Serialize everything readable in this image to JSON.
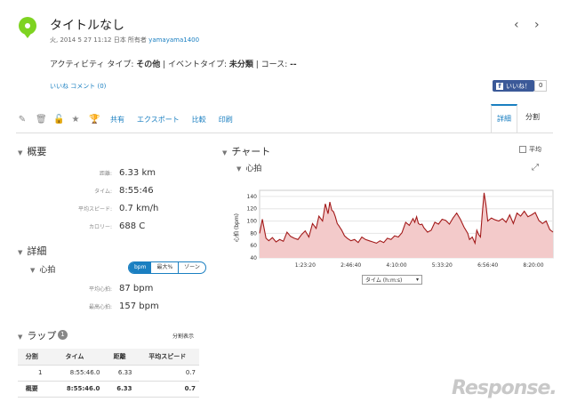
{
  "header": {
    "title": "タイトルなし",
    "date": "火, 2014 5 27 11:12 日本 所有者",
    "owner": "yamayama1400",
    "prev_glyph": "‹",
    "next_glyph": "›"
  },
  "activity": {
    "type_label": "アクティビティ タイプ: ",
    "type_value": "その他",
    "event_label": " | イベントタイプ: ",
    "event_value": "未分類",
    "course_label": " | コース: ",
    "course_value": "--"
  },
  "social": {
    "like_link": "いいね",
    "comment_link": "コメント (0)",
    "fb_like": "いいね！",
    "fb_count": "0"
  },
  "toolbar": {
    "icons": [
      "pencil-icon",
      "trash-icon",
      "lock-icon",
      "star-icon",
      "trophy-icon"
    ],
    "share": "共有",
    "export": "エクスポート",
    "compare": "比較",
    "print": "印刷"
  },
  "tabs": {
    "detail": "詳細",
    "split": "分割"
  },
  "overview": {
    "title": "概要",
    "stats": [
      {
        "label": "距離:",
        "value": "6.33 km"
      },
      {
        "label": "タイム:",
        "value": "8:55:46"
      },
      {
        "label": "平均スピード:",
        "value": "0.7 km/h"
      },
      {
        "label": "カロリー:",
        "value": "688 C"
      }
    ]
  },
  "details": {
    "title": "詳細",
    "hr_title": "心拍",
    "pill": [
      "bpm",
      "最大%",
      "ゾーン"
    ],
    "stats": [
      {
        "label": "平均心拍:",
        "value": "87 bpm"
      },
      {
        "label": "最高心拍:",
        "value": "157 bpm"
      }
    ]
  },
  "laps": {
    "title": "ラップ",
    "count": "1",
    "split_link": "分割表示",
    "headers": [
      "分割",
      "タイム",
      "距離",
      "平均スピード"
    ],
    "rows": [
      [
        "1",
        "8:55:46.0",
        "6.33",
        "0.7"
      ]
    ],
    "total": [
      "概要",
      "8:55:46.0",
      "6.33",
      "0.7"
    ]
  },
  "chart_panel": {
    "title": "チャート",
    "avg_label": "平均",
    "hr_title": "心拍",
    "axis_select": "タイム (h:m:s)"
  },
  "colors": {
    "accent": "#1a7fc1",
    "line": "#a31a1a",
    "fill": "#f3caca"
  },
  "chart_data": {
    "type": "area",
    "ylabel": "心拍 (bpm)",
    "xlabel": "",
    "ylim": [
      40,
      150
    ],
    "yticks": [
      40,
      60,
      80,
      100,
      120,
      140
    ],
    "xlim": [
      0,
      32146
    ],
    "xtick_labels": [
      "1:23:20",
      "2:46:40",
      "4:10:00",
      "5:33:20",
      "6:56:40",
      "8:20:00"
    ],
    "xtick_values": [
      5000,
      10000,
      15000,
      20000,
      25000,
      30000
    ],
    "series": [
      {
        "x": [
          0,
          300,
          700,
          1000,
          1400,
          1800,
          2200,
          2600,
          3000,
          3400,
          3800,
          4200,
          4600,
          5000,
          5400,
          5800,
          6200,
          6500,
          6900,
          7200,
          7500,
          7700,
          7900,
          8100,
          8300,
          8500,
          8700,
          9000,
          9300,
          9600,
          10000,
          10400,
          10800,
          11200,
          11600,
          12000,
          12400,
          12800,
          13200,
          13600,
          14000,
          14400,
          14800,
          15200,
          15600,
          16000,
          16400,
          16800,
          17000,
          17200,
          17400,
          17600,
          17800,
          18000,
          18400,
          18800,
          19200,
          19600,
          20000,
          20400,
          20800,
          21200,
          21600,
          22000,
          22400,
          22800,
          23000,
          23300,
          23600,
          23800,
          24000,
          24200,
          24400,
          24600,
          24800,
          25000,
          25400,
          25800,
          26200,
          26600,
          27000,
          27400,
          27800,
          28200,
          28600,
          29000,
          29400,
          29800,
          30200,
          30600,
          31000,
          31400,
          31800,
          32146
        ],
        "y": [
          80,
          103,
          72,
          68,
          73,
          66,
          70,
          67,
          82,
          75,
          72,
          70,
          78,
          84,
          74,
          96,
          88,
          108,
          100,
          128,
          112,
          131,
          118,
          115,
          107,
          96,
          92,
          85,
          76,
          72,
          68,
          70,
          65,
          74,
          70,
          68,
          66,
          64,
          68,
          65,
          72,
          70,
          76,
          74,
          81,
          98,
          93,
          104,
          98,
          107,
          96,
          94,
          95,
          89,
          82,
          85,
          98,
          95,
          103,
          101,
          95,
          105,
          113,
          103,
          90,
          80,
          70,
          74,
          64,
          85,
          78,
          74,
          113,
          146,
          126,
          100,
          105,
          102,
          100,
          104,
          98,
          110,
          96,
          113,
          108,
          116,
          107,
          110,
          114,
          101,
          96,
          100,
          86,
          82
        ]
      }
    ]
  }
}
